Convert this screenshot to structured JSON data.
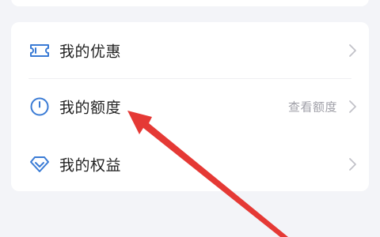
{
  "menu": {
    "items": [
      {
        "label": "我的优惠",
        "icon": "coupon-icon",
        "extra": ""
      },
      {
        "label": "我的额度",
        "icon": "clock-icon",
        "extra": "查看额度"
      },
      {
        "label": "我的权益",
        "icon": "diamond-icon",
        "extra": ""
      }
    ]
  },
  "colors": {
    "accent": "#3a7bd5",
    "annotation_arrow": "#e53935",
    "background": "#f3f4f8"
  }
}
